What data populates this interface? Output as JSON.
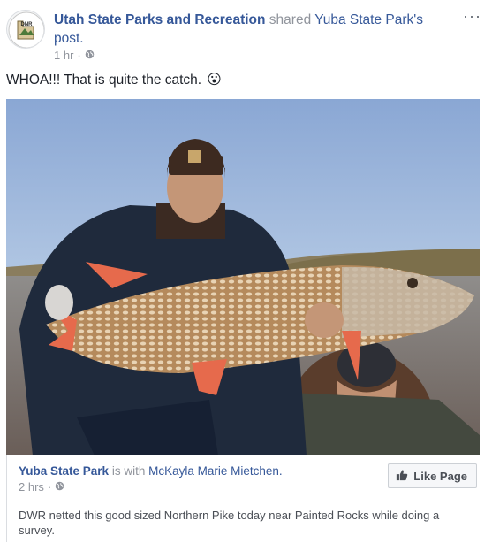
{
  "post": {
    "page_name": "Utah State Parks and Recreation",
    "shared_text": "shared",
    "shared_source": "Yuba State Park's",
    "post_word": "post.",
    "time": "1 hr",
    "separator": "·",
    "more_menu": "···",
    "body_text": "WHOA!!! That is quite the catch.",
    "emoji": "😮"
  },
  "avatar": {
    "logo_text": "DNR"
  },
  "photo": {
    "description": "fishing-photo"
  },
  "shared_post": {
    "page_name": "Yuba State Park",
    "with_text": "is with",
    "tagged_person": "McKayla Marie Mietchen.",
    "time": "2 hrs",
    "separator": "·",
    "like_page_label": "Like Page",
    "body_text": "DWR netted this good sized Northern Pike today near Painted Rocks while doing a survey."
  },
  "colors": {
    "link": "#365899",
    "muted": "#90949c",
    "text": "#1d2129"
  }
}
